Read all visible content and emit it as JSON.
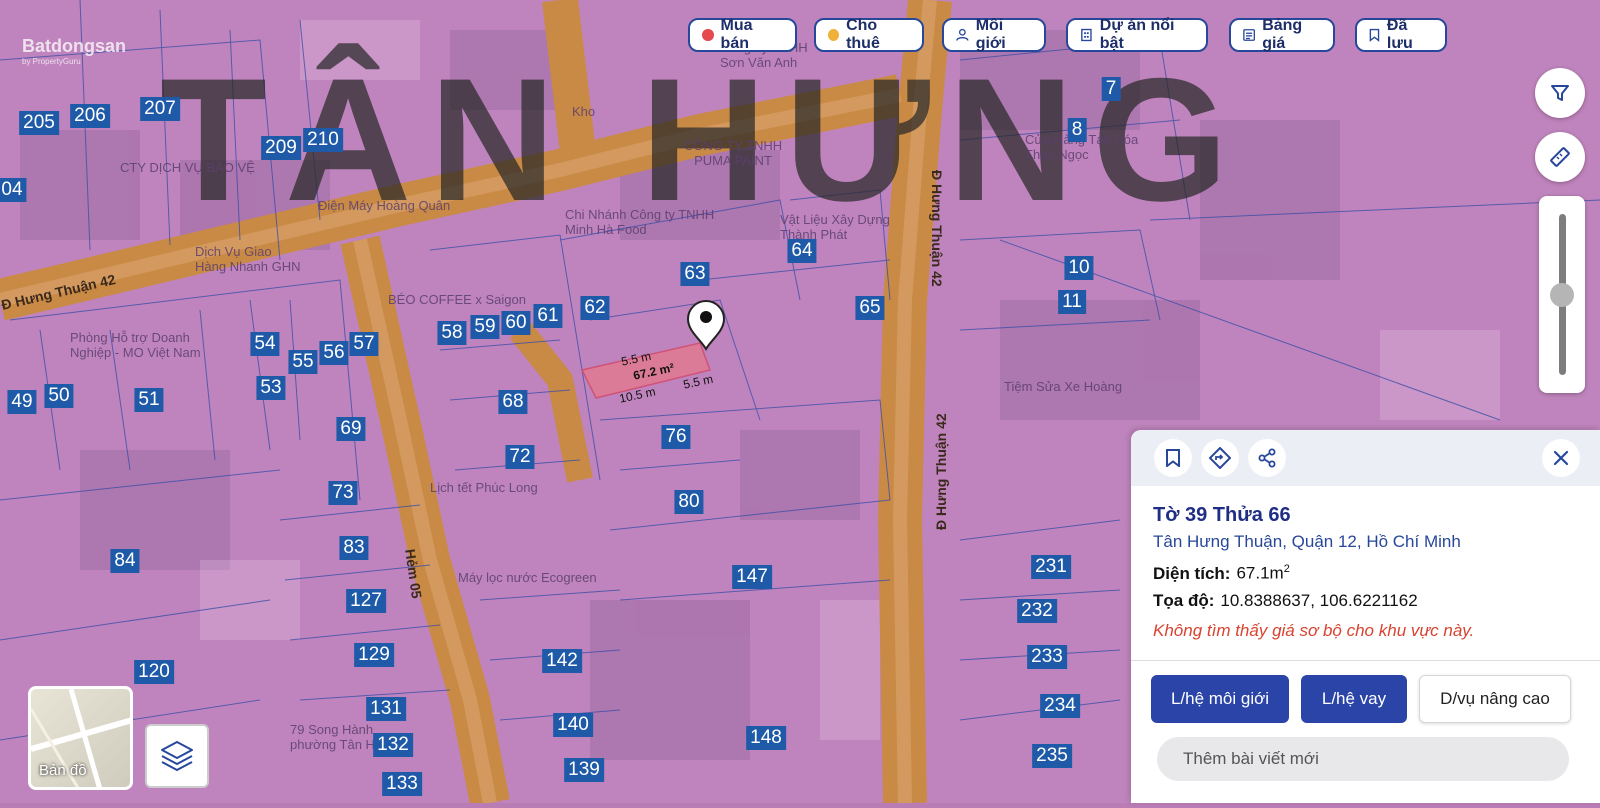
{
  "map": {
    "brand": "Batdongsan",
    "brand_sub": "by PropertyGuru",
    "watermark": "TÂN HƯNG",
    "road_labels": [
      "Đ Hưng Thuận 42",
      "Hẻm 05",
      "Đ Hưng Thuận 42",
      "Đ Hưng Thuận 42"
    ],
    "poi_labels": [
      "CTY DỊCH VỤ BẢO VỆ",
      "Điện Máy Hoàng Quân",
      "Dịch Vụ Giao Hàng Nhanh GHN",
      "Phòng Hỗ trợ Doanh Nghiệp - MO Việt Nam",
      "BÉO COFFEE x Saigon",
      "CÔNG TY TNHH PUMA PAINT",
      "Chi Nhánh Công ty TNHH Minh Hà Food",
      "Vật Liệu Xây Dựng Thành Phát",
      "Cửa Hàng Tạp Hóa Thảo Ngọc",
      "Tiệm Sửa Xe Hoàng",
      "Lịch tết Phúc Long",
      "Máy lọc nước Ecogreen",
      "79 Song Hành phường Tân Hưng",
      "Công Ty TNHH Sơn Văn Anh",
      "Kho"
    ],
    "plot_numbers": [
      "205",
      "206",
      "207",
      "209",
      "210",
      "04",
      "7",
      "8",
      "10",
      "11",
      "63",
      "64",
      "65",
      "62",
      "61",
      "60",
      "59",
      "58",
      "54",
      "55",
      "56",
      "57",
      "49",
      "50",
      "51",
      "53",
      "68",
      "69",
      "72",
      "73",
      "76",
      "80",
      "83",
      "84",
      "127",
      "129",
      "120",
      "131",
      "132",
      "133",
      "142",
      "140",
      "139",
      "147",
      "148",
      "231",
      "232",
      "233",
      "234",
      "235"
    ],
    "selected_parcel": {
      "side_top": "5.5 m",
      "area": "67.2 m²",
      "side_left": "10.5 m",
      "side_right": "5.5 m"
    }
  },
  "filters": [
    {
      "label": "Mua bán",
      "dot_color": "#e5484d"
    },
    {
      "label": "Cho thuê",
      "dot_color": "#f0b13a"
    },
    {
      "label": "Môi giới",
      "icon": "user-icon"
    },
    {
      "label": "Dự án nổi bật",
      "icon": "building-icon"
    },
    {
      "label": "Bảng giá",
      "icon": "price-table-icon"
    },
    {
      "label": "Đã lưu",
      "icon": "bookmark-icon"
    }
  ],
  "panel": {
    "title": "Tờ 39 Thửa 66",
    "address": "Tân Hưng Thuận, Quận 12, Hồ Chí Minh",
    "area_label": "Diện tích:",
    "area_value": "67.1m",
    "area_unit_sup": "2",
    "coord_label": "Tọa độ:",
    "coord_value": "10.8388637, 106.6221162",
    "price_notice": "Không tìm thấy giá sơ bộ cho khu vực này.",
    "btn_broker": "L/hệ môi giới",
    "btn_loan": "L/hệ vay",
    "btn_advanced": "D/vụ nâng cao",
    "post_placeholder": "Thêm bài viết mới"
  },
  "basemap_label": "Bản đồ"
}
